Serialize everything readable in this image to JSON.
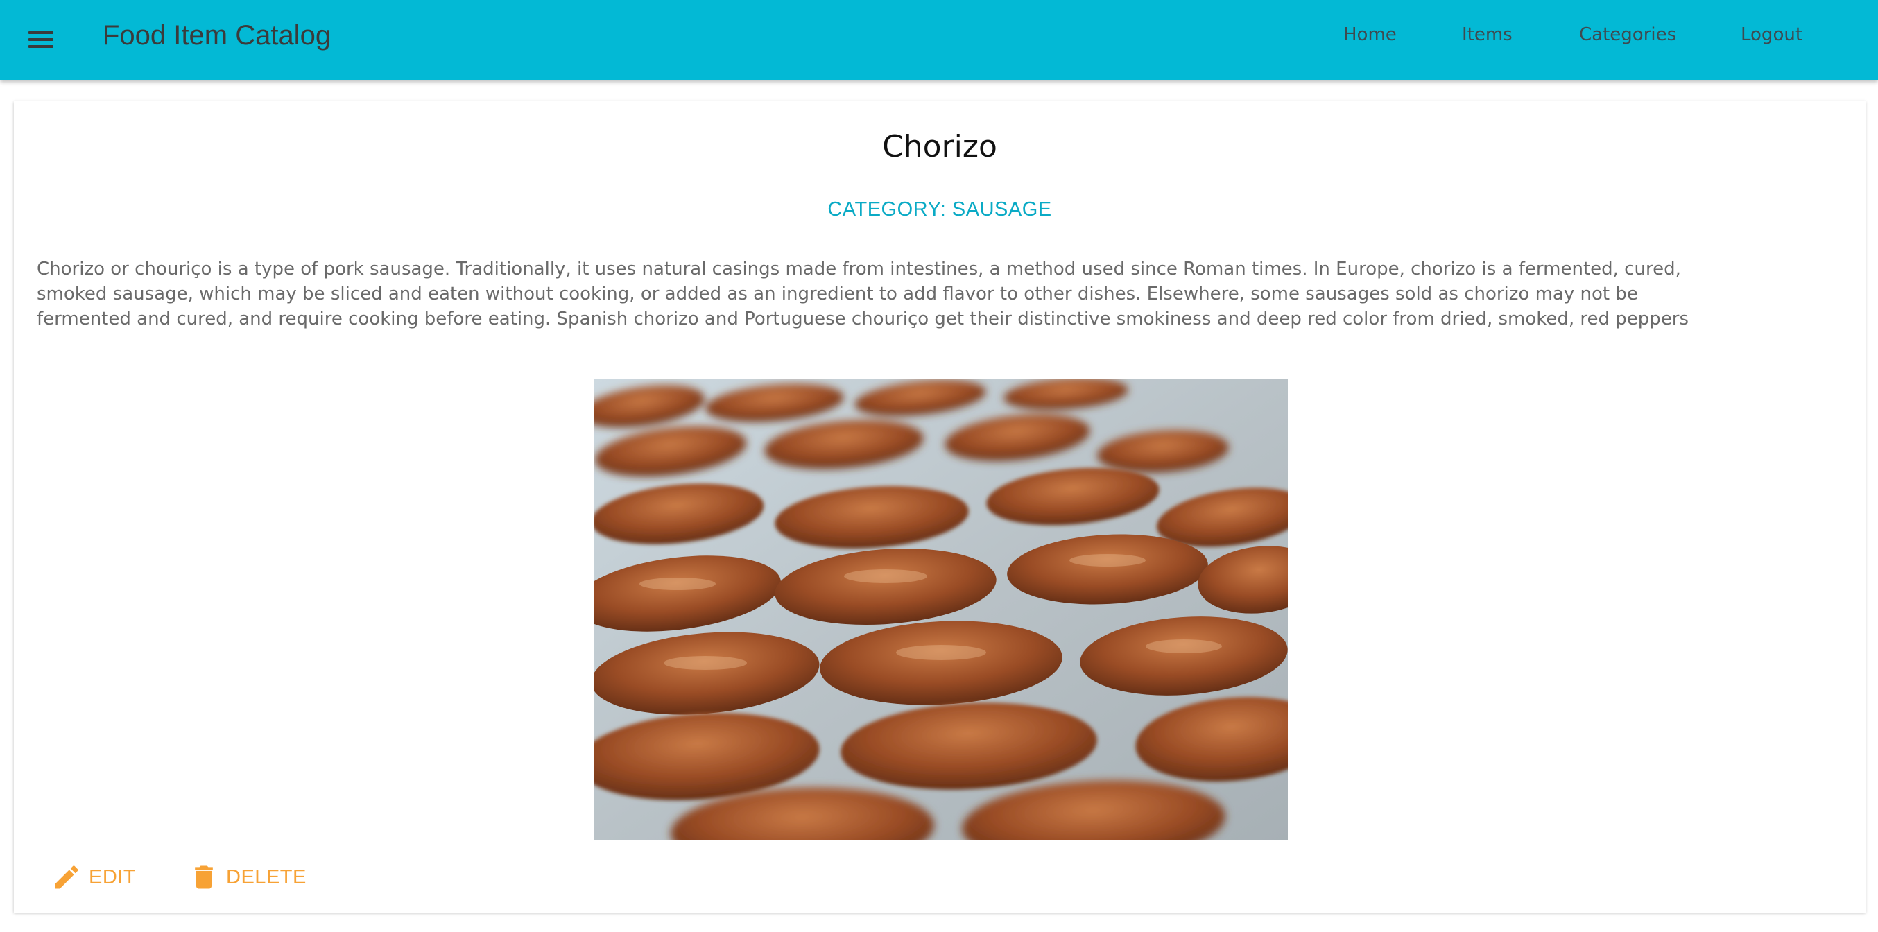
{
  "app": {
    "title": "Food Item Catalog",
    "menu_icon": "menu-icon",
    "accent_color": "#03b9d5"
  },
  "nav": {
    "items": [
      {
        "label": "Home"
      },
      {
        "label": "Items"
      },
      {
        "label": "Categories"
      },
      {
        "label": "Logout"
      }
    ]
  },
  "item": {
    "title": "Chorizo",
    "category_label": "CATEGORY: SAUSAGE",
    "description": "Chorizo or chouriço is a type of pork sausage. Traditionally, it uses natural casings made from intestines, a method used since Roman times. In Europe, chorizo is a fermented, cured, smoked sausage, which may be sliced and eaten without cooking, or added as an ingredient to add flavor to other dishes. Elsewhere, some sausages sold as chorizo may not be fermented and cured, and require cooking before eating. Spanish chorizo and Portuguese chouriço get their distinctive smokiness and deep red color from dried, smoked, red peppers",
    "image_subject": "chorizo sausages drying on a tray"
  },
  "actions": {
    "edit_label": "EDIT",
    "edit_icon": "pencil-icon",
    "delete_label": "DELETE",
    "delete_icon": "trash-icon",
    "action_color": "#f7a235"
  }
}
